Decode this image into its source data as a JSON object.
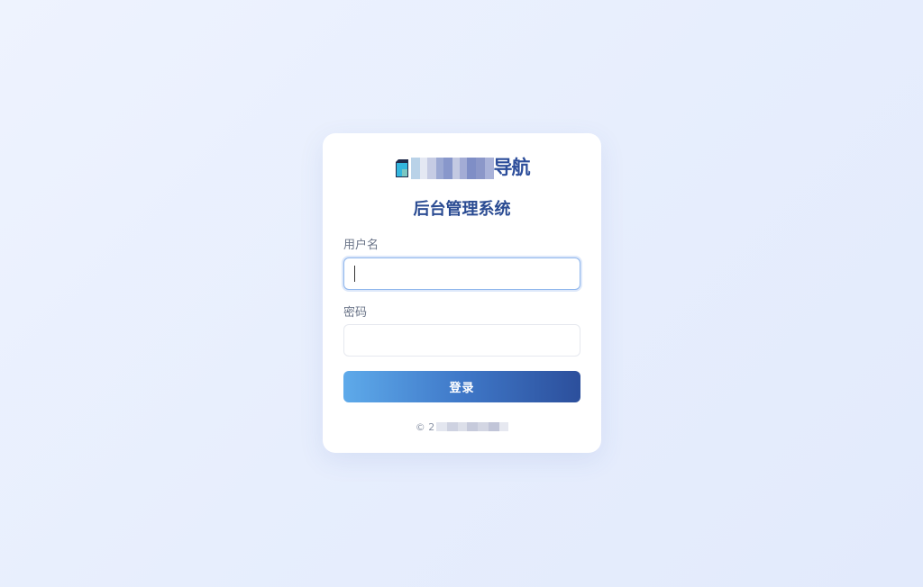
{
  "logo": {
    "text_suffix": "导航",
    "icon": "site-logo-icon",
    "redacted": true
  },
  "title": "后台管理系统",
  "form": {
    "username_label": "用户名",
    "username_value": "",
    "password_label": "密码",
    "password_value": "",
    "submit_label": "登录"
  },
  "footer": {
    "prefix": "© 2",
    "redacted": true
  },
  "colors": {
    "primary": "#2c4d9a",
    "accent": "#5eaaea",
    "label": "#6a7488",
    "focus_border": "#8fb6ec"
  }
}
